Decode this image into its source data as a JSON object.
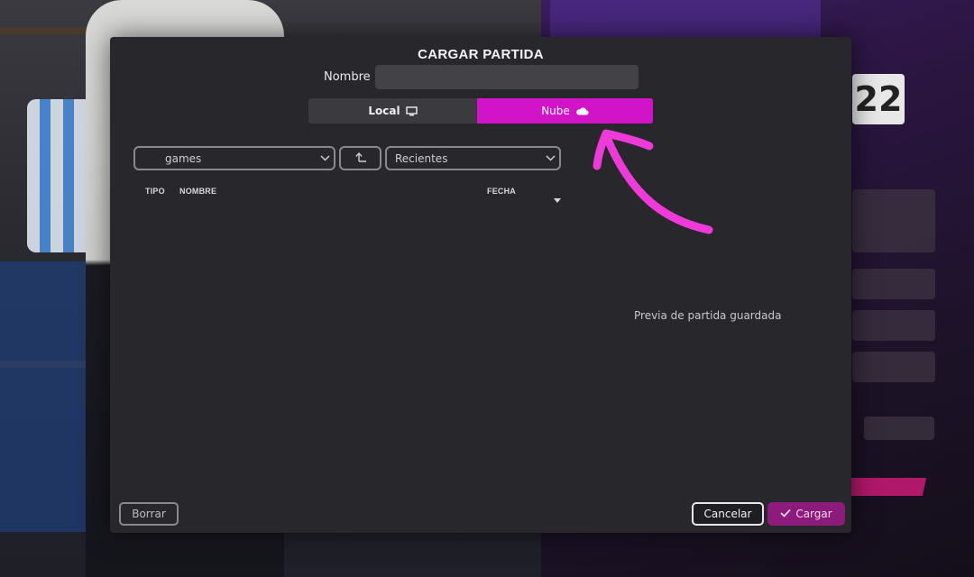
{
  "dialog": {
    "title": "CARGAR PARTIDA",
    "name_label": "Nombre",
    "name_value": "",
    "tabs": [
      {
        "label": "Local",
        "icon": "monitor-icon",
        "selected": false
      },
      {
        "label": "Nube",
        "icon": "cloud-icon",
        "selected": true
      }
    ],
    "folder_select": {
      "value": "games"
    },
    "sort_select": {
      "value": "Recientes"
    },
    "columns": {
      "tipo": "TIPO",
      "nombre": "NOMBRE",
      "fecha": "FECHA"
    },
    "preview_text": "Previa de partida guardada",
    "buttons": {
      "delete": "Borrar",
      "cancel": "Cancelar",
      "load": "Cargar"
    }
  },
  "background": {
    "badge": "22"
  },
  "colors": {
    "accent": "#d114c8",
    "load_button": "#8c1b7c",
    "annotation_arrow": "#ee3ad8",
    "dialog_bg": "#28272b"
  }
}
